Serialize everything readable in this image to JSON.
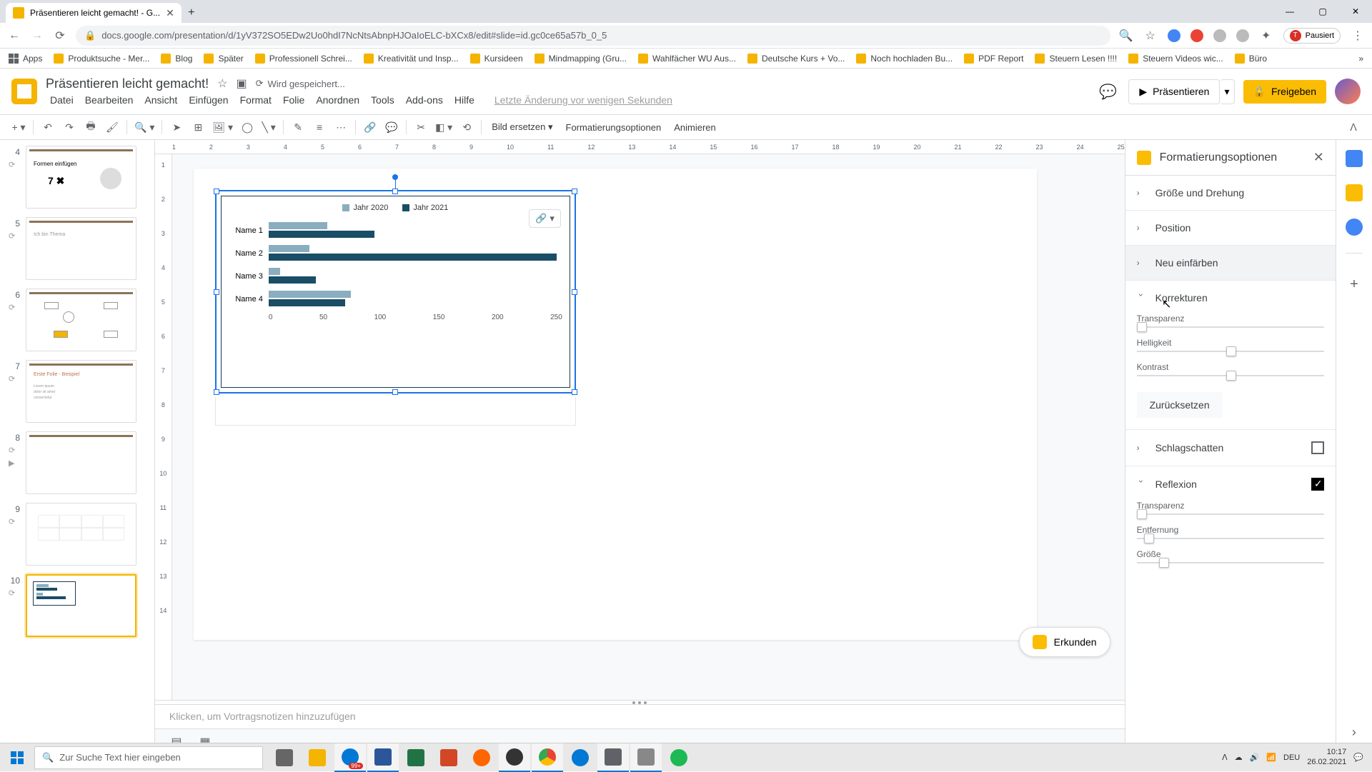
{
  "browser": {
    "tab_title": "Präsentieren leicht gemacht! - G...",
    "url": "docs.google.com/presentation/d/1yV372SO5EDw2Uo0hdI7NcNtsAbnpHJOaIoELC-bXCx8/edit#slide=id.gc0ce65a57b_0_5",
    "profile": "Pausiert",
    "bookmarks": [
      "Apps",
      "Produktsuche - Mer...",
      "Blog",
      "Später",
      "Professionell Schrei...",
      "Kreativität und Insp...",
      "Kursideen",
      "Mindmapping (Gru...",
      "Wahlfächer WU Aus...",
      "Deutsche Kurs + Vo...",
      "Noch hochladen Bu...",
      "PDF Report",
      "Steuern Lesen !!!!",
      "Steuern Videos wic...",
      "Büro"
    ]
  },
  "doc": {
    "title": "Präsentieren leicht gemacht!",
    "save_status": "Wird gespeichert...",
    "last_change": "Letzte Änderung vor wenigen Sekunden",
    "menus": [
      "Datei",
      "Bearbeiten",
      "Ansicht",
      "Einfügen",
      "Format",
      "Folie",
      "Anordnen",
      "Tools",
      "Add-ons",
      "Hilfe"
    ],
    "present": "Präsentieren",
    "share": "Freigeben"
  },
  "toolbar": {
    "replace_image": "Bild ersetzen",
    "format_options": "Formatierungsoptionen",
    "animate": "Animieren"
  },
  "thumbs": [
    {
      "num": "4"
    },
    {
      "num": "5"
    },
    {
      "num": "6"
    },
    {
      "num": "7"
    },
    {
      "num": "8"
    },
    {
      "num": "9"
    },
    {
      "num": "10"
    }
  ],
  "chart_data": {
    "type": "bar",
    "orientation": "horizontal",
    "categories": [
      "Name 1",
      "Name 2",
      "Name 3",
      "Name 4"
    ],
    "series": [
      {
        "name": "Jahr 2020",
        "color": "#8aadc0",
        "values": [
          50,
          35,
          10,
          70
        ]
      },
      {
        "name": "Jahr 2021",
        "color": "#1a4d66",
        "values": [
          90,
          245,
          40,
          65
        ]
      }
    ],
    "xlabel": "",
    "ylabel": "",
    "xlim": [
      0,
      250
    ],
    "xticks": [
      "0",
      "50",
      "100",
      "150",
      "200",
      "250"
    ]
  },
  "notes": {
    "placeholder": "Klicken, um Vortragsnotizen hinzuzufügen"
  },
  "explore": "Erkunden",
  "format_panel": {
    "title": "Formatierungsoptionen",
    "size_rotation": "Größe und Drehung",
    "position": "Position",
    "recolor": "Neu einfärben",
    "adjustments": "Korrekturen",
    "transparency": "Transparenz",
    "brightness": "Helligkeit",
    "contrast": "Kontrast",
    "reset": "Zurücksetzen",
    "drop_shadow": "Schlagschatten",
    "reflection": "Reflexion",
    "reflection_transparency": "Transparenz",
    "reflection_distance": "Entfernung",
    "reflection_size": "Größe"
  },
  "taskbar": {
    "search_placeholder": "Zur Suche Text hier eingeben",
    "lang": "DEU",
    "time": "10:17",
    "date": "26.02.2021",
    "notify_count": "99+"
  }
}
